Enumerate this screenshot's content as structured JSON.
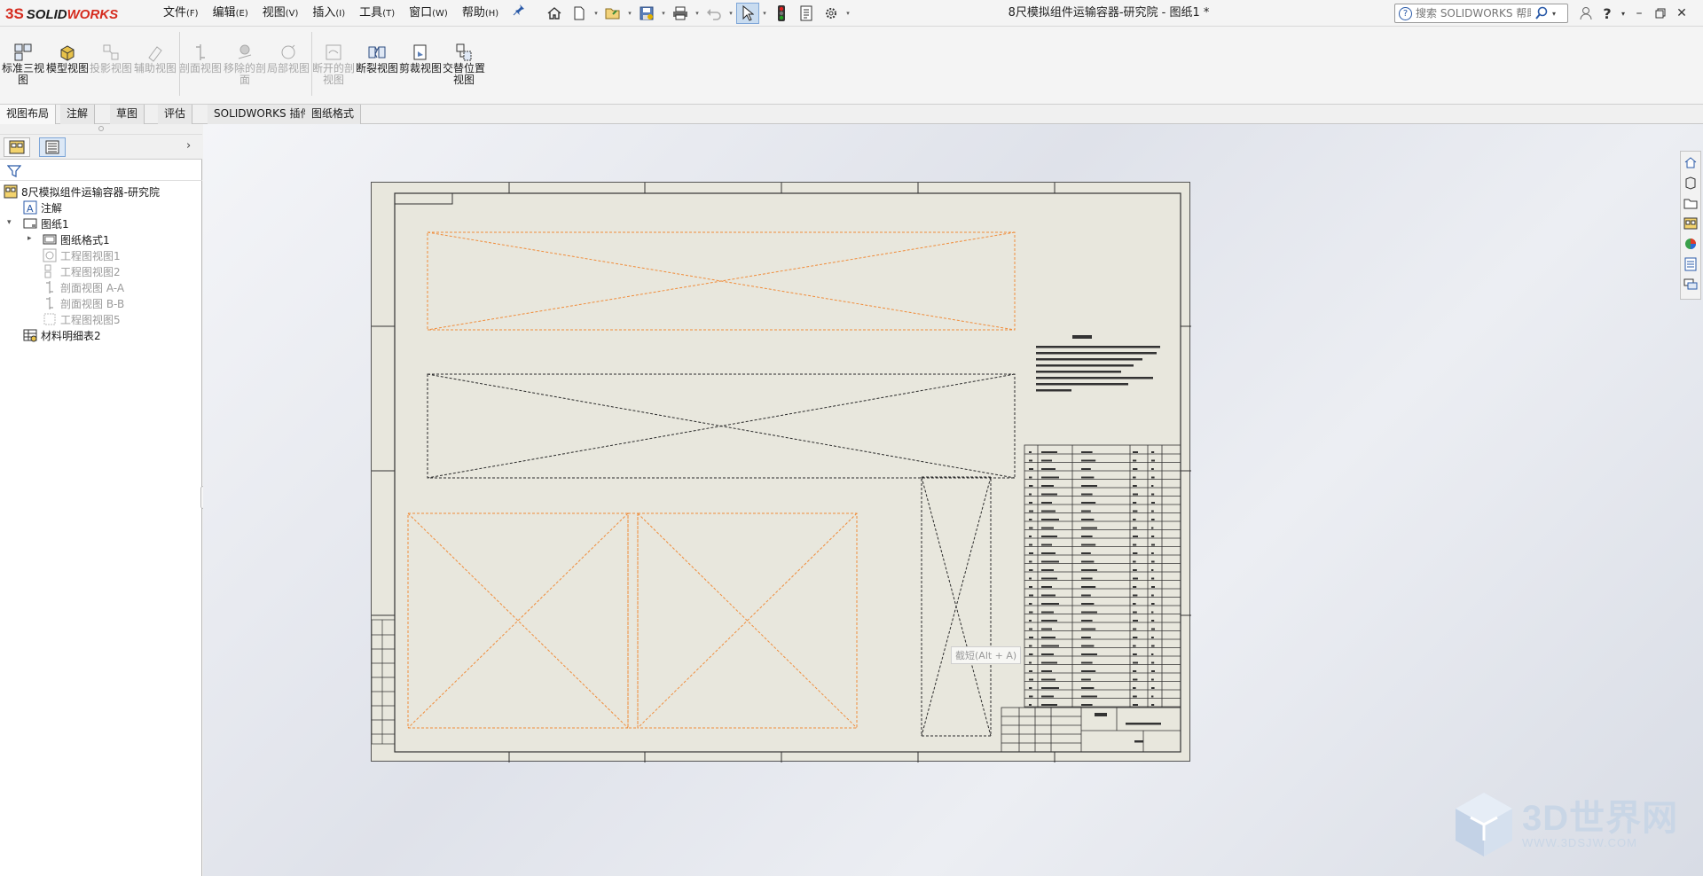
{
  "app": {
    "brand_ds": "3S",
    "brand_solid": "SOLID",
    "brand_works": "WORKS",
    "doc_title": "8尺模拟组件运输容器-研究院 - 图纸1 *"
  },
  "menu": [
    {
      "label": "文件",
      "acc": "(F)"
    },
    {
      "label": "编辑",
      "acc": "(E)"
    },
    {
      "label": "视图",
      "acc": "(V)"
    },
    {
      "label": "插入",
      "acc": "(I)"
    },
    {
      "label": "工具",
      "acc": "(T)"
    },
    {
      "label": "窗口",
      "acc": "(W)"
    },
    {
      "label": "帮助",
      "acc": "(H)"
    }
  ],
  "help_search": {
    "placeholder": "搜索 SOLIDWORKS 帮助"
  },
  "ribbon": {
    "buttons": [
      {
        "label": "标准三视图",
        "enabled": true,
        "icon": "standard-3-view-icon"
      },
      {
        "label": "模型视图",
        "enabled": true,
        "icon": "model-view-icon"
      },
      {
        "label": "投影视图",
        "enabled": false,
        "icon": "projected-view-icon"
      },
      {
        "label": "辅助视图",
        "enabled": false,
        "icon": "auxiliary-view-icon"
      },
      {
        "label": "剖面视图",
        "enabled": false,
        "icon": "section-view-icon"
      },
      {
        "label": "移除的剖面",
        "enabled": false,
        "icon": "removed-section-icon"
      },
      {
        "label": "局部视图",
        "enabled": false,
        "icon": "detail-view-icon"
      },
      {
        "label": "断开的剖视图",
        "enabled": false,
        "icon": "broken-out-section-icon"
      },
      {
        "label": "断裂视图",
        "enabled": true,
        "icon": "break-view-icon"
      },
      {
        "label": "剪裁视图",
        "enabled": true,
        "icon": "crop-view-icon"
      },
      {
        "label": "交替位置视图",
        "enabled": true,
        "icon": "alternate-position-view-icon"
      }
    ]
  },
  "tabs": [
    "视图布局",
    "注解",
    "草图",
    "评估",
    "SOLIDWORKS 插件",
    "图纸格式"
  ],
  "active_tab": "视图布局",
  "tree": {
    "root": "8尺模拟组件运输容器-研究院",
    "annotations": "注解",
    "sheet": "图纸1",
    "sheet_format": "图纸格式1",
    "views": [
      "工程图视图1",
      "工程图视图2",
      "剖面视图 A-A",
      "剖面视图 B-B",
      "工程图视图5"
    ],
    "bom": "材料明细表2"
  },
  "tooltip": "截短(Alt + A)",
  "watermark": {
    "big": "3D世界网",
    "small": "WWW.3DSJW.COM"
  },
  "colors": {
    "accent": "#d52b1e",
    "sheet": "#e8e7dd",
    "view_orange": "#f08c3a",
    "view_dark": "#2a2a2a"
  }
}
